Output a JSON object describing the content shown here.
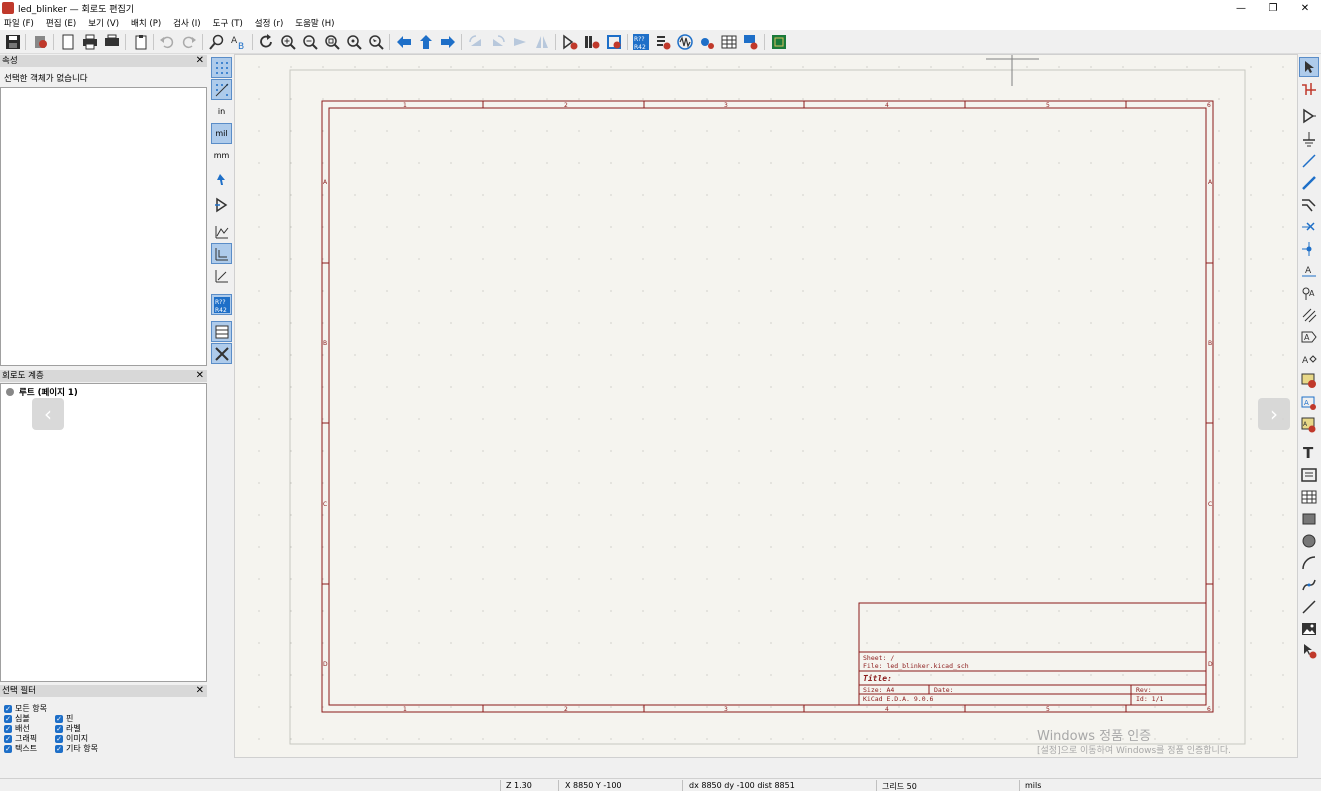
{
  "window": {
    "title": "led_blinker — 회로도 편집기",
    "controls": [
      "—",
      "❐",
      "✕"
    ]
  },
  "menu": [
    "파일 (F)",
    "편집 (E)",
    "보기 (V)",
    "배치 (P)",
    "검사 (I)",
    "도구 (T)",
    "설정 (r)",
    "도움말 (H)"
  ],
  "toolbar": {
    "icons": [
      "save-icon",
      "schematic-setup-icon",
      "page-settings-icon",
      "print-icon",
      "plot-icon",
      "paste-icon",
      "undo-icon",
      "redo-icon",
      "find-icon",
      "find-replace-icon",
      "refresh-icon",
      "zoom-in-icon",
      "zoom-out-icon",
      "zoom-fit-icon",
      "zoom-objects-icon",
      "zoom-selection-icon",
      "navigate-back-icon",
      "navigate-up-icon",
      "navigate-forward-icon",
      "rotate-ccw-icon",
      "rotate-cw-icon",
      "mirror-h-icon",
      "mirror-v-icon",
      "symbol-editor-icon",
      "symbol-browser-icon",
      "footprint-assign-icon",
      "annotate-icon",
      "erc-icon",
      "simulator-icon",
      "bom-icon",
      "table-icon",
      "edit-fields-icon",
      "pcb-editor-icon"
    ]
  },
  "panels": {
    "properties": {
      "title": "속성",
      "empty_text": "선택한 객체가 없습니다"
    },
    "hierarchy": {
      "title": "회로도 계층",
      "root": "루트 (페이지 1)"
    },
    "selection_filter": {
      "title": "선택 필터",
      "items": [
        "모든 항목",
        "심볼",
        "핀",
        "배선",
        "라벨",
        "그래픽",
        "이미지",
        "텍스트",
        "기타 항목"
      ]
    }
  },
  "left_tools": {
    "unit_in": "in",
    "unit_mil": "mil",
    "unit_mm": "mm",
    "icons": [
      "grid-dots-icon",
      "grid-overrides-icon",
      "unit-inch-icon",
      "unit-mil-icon",
      "unit-mm-icon",
      "cursor-crosshair-icon",
      "hidden-pins-icon",
      "line-mode-free-icon",
      "line-mode-90-icon",
      "line-mode-45-icon",
      "annotate-display-icon",
      "properties-panel-icon",
      "tools-icon"
    ]
  },
  "right_tools": {
    "icons": [
      "select-icon",
      "highlight-net-icon",
      "add-symbol-icon",
      "add-power-icon",
      "add-wire-icon",
      "add-bus-icon",
      "add-bus-entry-icon",
      "no-connect-icon",
      "add-junction-icon",
      "add-label-icon",
      "add-net-class-icon",
      "add-rule-area-icon",
      "add-global-label-icon",
      "add-hier-label-icon",
      "add-sheet-icon",
      "import-sheet-pin-icon",
      "sync-sheet-pins-icon",
      "add-text-icon",
      "add-textbox-icon",
      "add-table-icon",
      "add-rectangle-icon",
      "add-circle-icon",
      "add-arc-icon",
      "add-bezier-icon",
      "add-line-icon",
      "add-image-icon",
      "delete-icon"
    ]
  },
  "sheet": {
    "columns": [
      "1",
      "2",
      "3",
      "4",
      "5",
      "6"
    ],
    "rows": [
      "A",
      "B",
      "C",
      "D"
    ],
    "title_block": {
      "sheet": "Sheet: /",
      "file": "File: led_blinker.kicad_sch",
      "title": "Title:",
      "size": "Size: A4",
      "date": "Date:",
      "rev": "Rev:",
      "kicad": "KiCad E.D.A. 9.0.6",
      "id": "Id: 1/1"
    }
  },
  "watermark": {
    "line1": "Windows 정품 인증",
    "line2": "[설정]으로 이동하여 Windows를 정품 인증합니다."
  },
  "status": {
    "zoom": "Z 1.30",
    "xy": "X 8850  Y -100",
    "delta": "dx 8850  dy -100  dist 8851",
    "grid": "그리드 50",
    "units": "mils"
  },
  "colors": {
    "sheet_border": "#8b1a1a",
    "accent_blue": "#1e6fc8",
    "canvas_bg": "#f5f4ef"
  }
}
